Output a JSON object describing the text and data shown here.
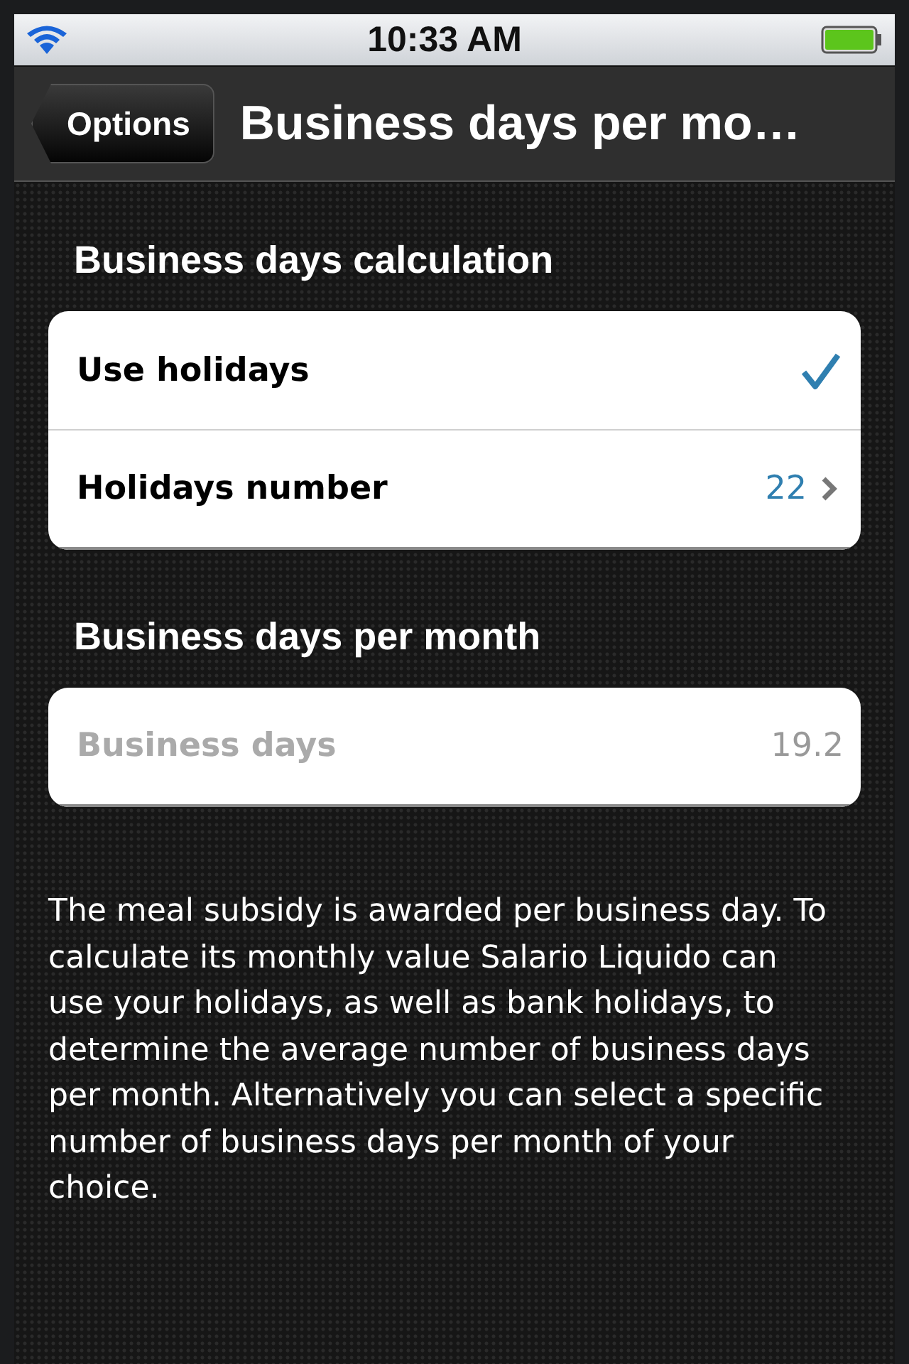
{
  "status_bar": {
    "time": "10:33 AM"
  },
  "nav_bar": {
    "back_button": "Options",
    "title": "Business days per mo…"
  },
  "sections": [
    {
      "header": "Business days calculation",
      "rows": [
        {
          "kind": "check",
          "label": "Use holidays",
          "checked": true,
          "disabled": false
        },
        {
          "kind": "disclosure",
          "label": "Holidays number",
          "value": "22",
          "disabled": false
        }
      ]
    },
    {
      "header": "Business days per month",
      "rows": [
        {
          "kind": "value",
          "label": "Business days",
          "value": "19.2",
          "disabled": true
        }
      ]
    }
  ],
  "footer": "The meal subsidy is awarded per business day. To calculate its monthly value Salario Liquido can use your holidays, as well as bank holidays, to determine the average number of business days per month. Alternatively you can select a specific number of business days per month of your choice."
}
